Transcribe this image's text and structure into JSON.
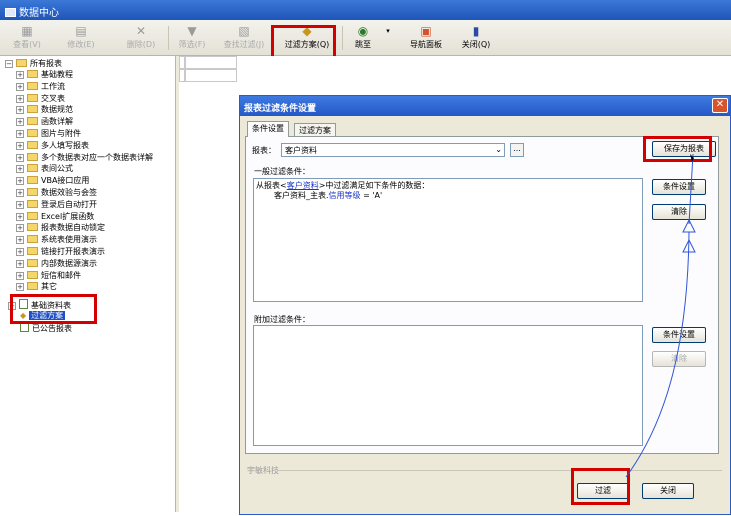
{
  "app": {
    "title": "数据中心"
  },
  "toolbar": {
    "buttons": [
      {
        "label": "查看(V)",
        "icon": "view-icon",
        "disabled": true
      },
      {
        "label": "修改(E)",
        "icon": "edit-icon",
        "disabled": true
      },
      {
        "label": "删除(D)",
        "icon": "delete-icon",
        "disabled": true
      },
      {
        "label": "筛选(F)",
        "icon": "funnel-icon",
        "disabled": true
      },
      {
        "label": "查找过滤(J)",
        "icon": "find-filter-icon",
        "disabled": true
      },
      {
        "label": "过滤方案(Q)",
        "icon": "filter-scheme-icon",
        "disabled": false
      },
      {
        "label": "跳至",
        "icon": "jump-to-icon",
        "disabled": false
      },
      {
        "label": "导航面板",
        "icon": "nav-panel-icon",
        "disabled": false
      },
      {
        "label": "关闭(Q)",
        "icon": "close-book-icon",
        "disabled": false
      }
    ]
  },
  "tree": {
    "root": "所有报表",
    "children": [
      "基础教程",
      "工作流",
      "交叉表",
      "数据规范",
      "函数详解",
      "图片与附件",
      "多人填写报表",
      "多个数据表对应一个数据表详解",
      "表间公式",
      "VBA接口应用",
      "数据效验与会签",
      "登录后自动打开",
      "Excel扩展函数",
      "报表数据自动锁定",
      "系统表使用演示",
      "链接打开报表演示",
      "内部数据源演示",
      "短信和邮件",
      "其它"
    ],
    "basic_node": "基础资料表",
    "filter_node": "过滤方案",
    "published_node": "已公告报表"
  },
  "dialog": {
    "title": "报表过滤条件设置",
    "tabs": [
      "条件设置",
      "过滤方案"
    ],
    "report_label": "报表：",
    "report_value": "客户资料",
    "more_button": "...",
    "save_scheme_button": "保存为报表",
    "general_label": "一般过滤条件：",
    "condition_line1_prefix": "从报表<",
    "condition_line1_report": "客户资料",
    "condition_line1_suffix": ">中过滤满足如下条件的数据：",
    "condition_line2_field": "客户资料_主表.",
    "condition_line2_name": "信用等级",
    "condition_line2_op": " = 'A'",
    "cond_set_button": "条件设置",
    "clear_button": "清除",
    "extra_label": "附加过滤条件：",
    "extra_cond_set_button": "条件设置",
    "extra_clear_button": "清除",
    "footer_brand": "宇敏科技",
    "filter_button": "过滤",
    "close_button": "关闭",
    "close_x": "✕"
  },
  "colors": {
    "highlight": "#d40000",
    "titlebar": "#2458c7",
    "accent_blue": "#1a34c8"
  }
}
